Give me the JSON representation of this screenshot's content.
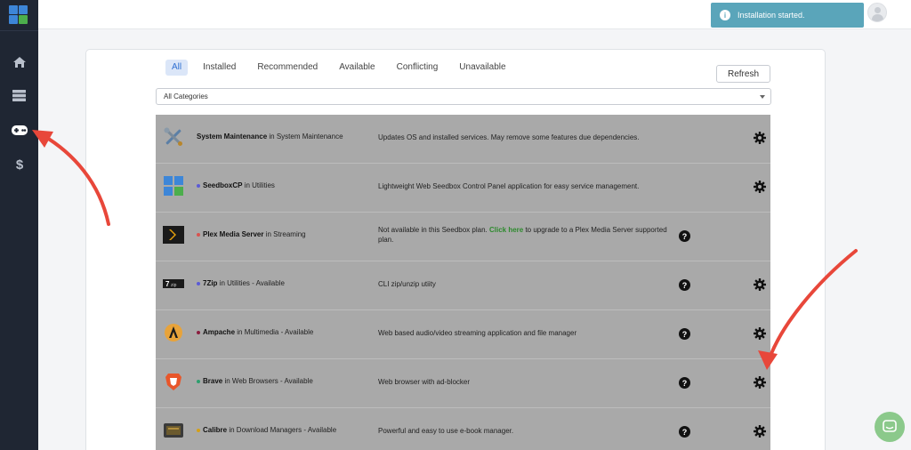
{
  "sidebar": {
    "logo": "seedboxcp-logo",
    "items": [
      {
        "icon": "home-icon"
      },
      {
        "icon": "server-icon"
      },
      {
        "icon": "gamepad-icon"
      },
      {
        "icon": "dollar-icon"
      }
    ]
  },
  "toast": {
    "message": "Installation started.",
    "icon": "info-icon"
  },
  "tabs": [
    {
      "label": "All",
      "active": true
    },
    {
      "label": "Installed"
    },
    {
      "label": "Recommended"
    },
    {
      "label": "Available"
    },
    {
      "label": "Conflicting"
    },
    {
      "label": "Unavailable"
    }
  ],
  "refresh_label": "Refresh",
  "category_select": {
    "value": "All Categories"
  },
  "apps": [
    {
      "name": "System Maintenance",
      "category": " in System Maintenance",
      "description": "Updates OS and installed services. May remove some features due dependencies.",
      "icon": "tools-icon",
      "help": false,
      "settings": true
    },
    {
      "name": "SeedboxCP",
      "category": " in Utilities",
      "dot_color": "#5b5bd6",
      "description": "Lightweight Web Seedbox Control Panel application for easy service management.",
      "icon": "seedboxcp-icon",
      "help": false,
      "settings": true
    },
    {
      "name": "Plex Media Server",
      "category": " in Streaming",
      "dot_color": "#d9534f",
      "description_pre": "Not available in this Seedbox plan. ",
      "description_link": "Click here",
      "description_post": " to upgrade to a Plex Media Server supported plan.",
      "icon": "plex-icon",
      "help": true,
      "settings": false
    },
    {
      "name": "7Zip",
      "category": " in Utilities - Available",
      "dot_color": "#5b5bd6",
      "description": "CLI zip/unzip utiity",
      "icon": "7zip-icon",
      "help": true,
      "settings": true
    },
    {
      "name": "Ampache",
      "category": " in Multimedia - Available",
      "dot_color": "#8b1e3f",
      "description": "Web based audio/video streaming application and file manager",
      "icon": "ampache-icon",
      "help": true,
      "settings": true
    },
    {
      "name": "Brave",
      "category": " in Web Browsers - Available",
      "dot_color": "#2e9e6e",
      "description": "Web browser with ad-blocker",
      "icon": "brave-icon",
      "help": true,
      "settings": true
    },
    {
      "name": "Calibre",
      "category": " in Download Managers - Available",
      "dot_color": "#d4a017",
      "description": "Powerful and easy to use e-book manager.",
      "icon": "calibre-icon",
      "help": true,
      "settings": true
    }
  ],
  "help_glyph": "?",
  "colors": {
    "sidebar": "#1f2633",
    "toast": "#5aa5ba",
    "accent": "#2f6fd1",
    "arrow": "#e8473a",
    "chat": "#8bc98b"
  }
}
